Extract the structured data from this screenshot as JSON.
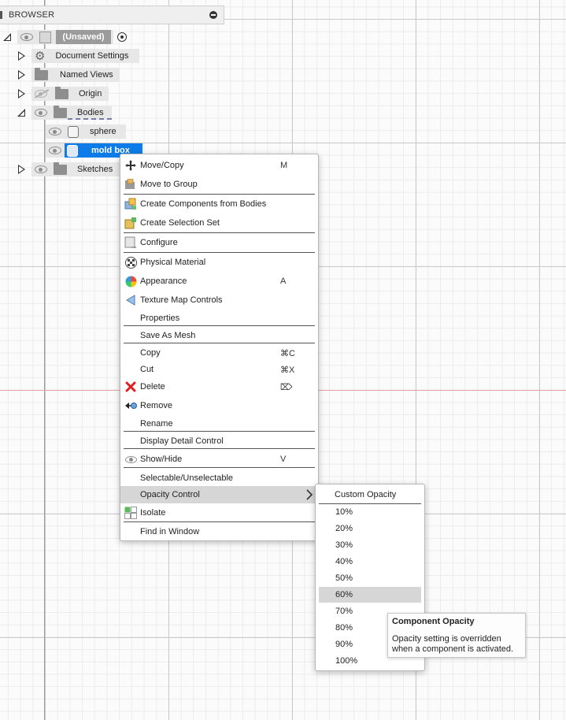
{
  "browser": {
    "title": "BROWSER",
    "root": {
      "label": "(Unsaved)"
    },
    "items": [
      {
        "label": "Document Settings"
      },
      {
        "label": "Named Views"
      },
      {
        "label": "Origin"
      },
      {
        "label": "Bodies"
      },
      {
        "label": "sphere"
      },
      {
        "label": "mold box"
      },
      {
        "label": "Sketches"
      }
    ]
  },
  "context_menu": {
    "items": [
      {
        "label": "Move/Copy",
        "shortcut": "M",
        "icon": "move-icon"
      },
      {
        "label": "Move to Group",
        "icon": "move-to-group-icon"
      },
      {
        "label": "Create Components from Bodies",
        "icon": "create-components-icon"
      },
      {
        "label": "Create Selection Set",
        "icon": "selection-set-icon"
      },
      {
        "label": "Configure",
        "icon": "configure-icon"
      },
      {
        "label": "Physical Material",
        "icon": "physical-material-icon"
      },
      {
        "label": "Appearance",
        "shortcut": "A",
        "icon": "appearance-icon"
      },
      {
        "label": "Texture Map Controls",
        "icon": "texture-map-icon"
      },
      {
        "label": "Properties"
      },
      {
        "label": "Save As Mesh"
      },
      {
        "label": "Copy",
        "shortcut": "⌘C"
      },
      {
        "label": "Cut",
        "shortcut": "⌘X"
      },
      {
        "label": "Delete",
        "shortcut": "⌦",
        "icon": "delete-icon"
      },
      {
        "label": "Remove",
        "icon": "remove-icon"
      },
      {
        "label": "Rename"
      },
      {
        "label": "Display Detail Control"
      },
      {
        "label": "Show/Hide",
        "shortcut": "V",
        "icon": "eye-icon"
      },
      {
        "label": "Selectable/Unselectable"
      },
      {
        "label": "Opacity Control"
      },
      {
        "label": "Isolate",
        "icon": "isolate-icon"
      },
      {
        "label": "Find in Window"
      }
    ]
  },
  "opacity_submenu": {
    "header": "Custom Opacity",
    "options": [
      "10%",
      "20%",
      "30%",
      "40%",
      "50%",
      "60%",
      "70%",
      "80%",
      "90%",
      "100%"
    ],
    "highlighted": "60%"
  },
  "tooltip": {
    "title": "Component Opacity",
    "body": "Opacity setting is overridden when a component is activated."
  },
  "colors": {
    "selection": "#0e7ce8",
    "menu_highlight": "#d6d6d6",
    "delete_red": "#e02020",
    "origin_axis": "#e8a0a0"
  }
}
